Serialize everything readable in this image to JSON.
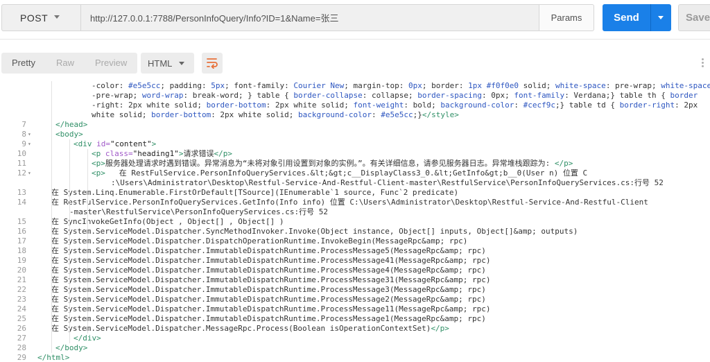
{
  "request": {
    "method": "POST",
    "url": "http://127.0.0.1:7788/PersonInfoQuery/Info?ID=1&Name=张三",
    "params_label": "Params",
    "send_label": "Send",
    "save_label": "Save"
  },
  "response_toolbar": {
    "tabs": [
      "Pretty",
      "Raw",
      "Preview"
    ],
    "active_tab": "Pretty",
    "format": "HTML"
  },
  "code_lines": [
    {
      "num": "",
      "indent": 132,
      "segments": [
        [
          "-color: ",
          "c"
        ],
        [
          "#e5e5cc",
          "k"
        ],
        [
          "; padding: ",
          "c"
        ],
        [
          "5px",
          "k"
        ],
        [
          "; font-family: ",
          "c"
        ],
        [
          "Courier New",
          "k"
        ],
        [
          "; margin-top: ",
          "c"
        ],
        [
          "0px",
          "k"
        ],
        [
          "; border: ",
          "c"
        ],
        [
          "1px #f0f0e0",
          "k"
        ],
        [
          " solid; ",
          "c"
        ],
        [
          "white-space",
          "k"
        ],
        [
          ": pre-wrap; ",
          "c"
        ],
        [
          "white-space",
          "k"
        ]
      ]
    },
    {
      "num": "",
      "indent": 132,
      "segments": [
        [
          "-pre-wrap; ",
          "c"
        ],
        [
          "word-wrap",
          "k"
        ],
        [
          ": break-word; } table { ",
          "c"
        ],
        [
          "border-collapse",
          "k"
        ],
        [
          ": collapse; ",
          "c"
        ],
        [
          "border-spacing",
          "k"
        ],
        [
          ": 0px; ",
          "c"
        ],
        [
          "font-family",
          "k"
        ],
        [
          ": Verdana;} table th { ",
          "c"
        ],
        [
          "border",
          "k"
        ]
      ]
    },
    {
      "num": "",
      "indent": 132,
      "segments": [
        [
          "-right: 2px white solid; ",
          "c"
        ],
        [
          "border-bottom",
          "k"
        ],
        [
          ": 2px white solid; ",
          "c"
        ],
        [
          "font-weight",
          "k"
        ],
        [
          ": bold; ",
          "c"
        ],
        [
          "background-color",
          "k"
        ],
        [
          ": ",
          "c"
        ],
        [
          "#cecf9c",
          "k"
        ],
        [
          ";} table td { ",
          "c"
        ],
        [
          "border-right",
          "k"
        ],
        [
          ": 2px",
          "c"
        ]
      ]
    },
    {
      "num": "",
      "indent": 132,
      "segments": [
        [
          "white solid; ",
          "c"
        ],
        [
          "border-bottom",
          "k"
        ],
        [
          ": 2px white solid; ",
          "c"
        ],
        [
          "background-color",
          "k"
        ],
        [
          ": ",
          "c"
        ],
        [
          "#e5e5cc",
          "k"
        ],
        [
          ";}",
          "c"
        ],
        [
          "</style>",
          "t"
        ]
      ]
    },
    {
      "num": "7",
      "indent": 80,
      "segments": [
        [
          "</head>",
          "t"
        ]
      ]
    },
    {
      "num": "8",
      "fold": true,
      "indent": 80,
      "segments": [
        [
          "<body>",
          "t"
        ]
      ]
    },
    {
      "num": "9",
      "fold": true,
      "indent": 106,
      "segments": [
        [
          "<div ",
          "t"
        ],
        [
          "id=",
          "a"
        ],
        [
          "\"content\"",
          "s"
        ],
        [
          ">",
          "t"
        ]
      ]
    },
    {
      "num": "10",
      "indent": 132,
      "segments": [
        [
          "<p ",
          "t"
        ],
        [
          "class=",
          "a"
        ],
        [
          "\"heading1\"",
          "s"
        ],
        [
          ">",
          "t"
        ],
        [
          "请求错误",
          "c"
        ],
        [
          "</p>",
          "t"
        ]
      ]
    },
    {
      "num": "11",
      "indent": 132,
      "segments": [
        [
          "<p>",
          "t"
        ],
        [
          "服务器处理请求时遇到错误。异常消息为“未将对象引用设置到对象的实例。”。有关详细信息，请参见服务器日志。异常堆栈跟踪为: ",
          "c"
        ],
        [
          "</p>",
          "t"
        ]
      ]
    },
    {
      "num": "12",
      "fold": true,
      "indent": 132,
      "segments": [
        [
          "<p>",
          "t"
        ],
        [
          "   在 RestFulService.PersonInfoQueryServices.&lt;&gt;c__DisplayClass3_0.&lt;GetInfo&gt;b__0(User n) 位置 C",
          "c"
        ]
      ]
    },
    {
      "num": "",
      "indent": 160,
      "segments": [
        [
          ":\\Users\\Administrator\\Desktop\\Restful-Service-And-Restful-Client-master\\RestfulService\\PersonInfoQueryServices.cs:行号 52",
          "c"
        ]
      ]
    },
    {
      "num": "13",
      "indent": 74,
      "segments": [
        [
          "在 System.Linq.Enumerable.FirstOrDefault[TSource](IEnumerable`1 source, Func`2 predicate)",
          "c"
        ]
      ]
    },
    {
      "num": "14",
      "indent": 74,
      "segments": [
        [
          "在 RestFulService.PersonInfoQueryServices.GetInfo(Info info) 位置 C:\\Users\\Administrator\\Desktop\\Restful-Service-And-Restful-Client",
          "c"
        ]
      ]
    },
    {
      "num": "",
      "indent": 100,
      "segments": [
        [
          "-master\\RestfulService\\PersonInfoQueryServices.cs:行号 52",
          "c"
        ]
      ]
    },
    {
      "num": "15",
      "indent": 74,
      "segments": [
        [
          "在 SyncInvokeGetInfo(Object , Object[] , Object[] )",
          "c"
        ]
      ]
    },
    {
      "num": "16",
      "indent": 74,
      "segments": [
        [
          "在 System.ServiceModel.Dispatcher.SyncMethodInvoker.Invoke(Object instance, Object[] inputs, Object[]&amp; outputs)",
          "c"
        ]
      ]
    },
    {
      "num": "17",
      "indent": 74,
      "segments": [
        [
          "在 System.ServiceModel.Dispatcher.DispatchOperationRuntime.InvokeBegin(MessageRpc&amp; rpc)",
          "c"
        ]
      ]
    },
    {
      "num": "18",
      "indent": 74,
      "segments": [
        [
          "在 System.ServiceModel.Dispatcher.ImmutableDispatchRuntime.ProcessMessage5(MessageRpc&amp; rpc)",
          "c"
        ]
      ]
    },
    {
      "num": "19",
      "indent": 74,
      "segments": [
        [
          "在 System.ServiceModel.Dispatcher.ImmutableDispatchRuntime.ProcessMessage41(MessageRpc&amp; rpc)",
          "c"
        ]
      ]
    },
    {
      "num": "20",
      "indent": 74,
      "segments": [
        [
          "在 System.ServiceModel.Dispatcher.ImmutableDispatchRuntime.ProcessMessage4(MessageRpc&amp; rpc)",
          "c"
        ]
      ]
    },
    {
      "num": "21",
      "indent": 74,
      "segments": [
        [
          "在 System.ServiceModel.Dispatcher.ImmutableDispatchRuntime.ProcessMessage31(MessageRpc&amp; rpc)",
          "c"
        ]
      ]
    },
    {
      "num": "22",
      "indent": 74,
      "segments": [
        [
          "在 System.ServiceModel.Dispatcher.ImmutableDispatchRuntime.ProcessMessage3(MessageRpc&amp; rpc)",
          "c"
        ]
      ]
    },
    {
      "num": "23",
      "indent": 74,
      "segments": [
        [
          "在 System.ServiceModel.Dispatcher.ImmutableDispatchRuntime.ProcessMessage2(MessageRpc&amp; rpc)",
          "c"
        ]
      ]
    },
    {
      "num": "24",
      "indent": 74,
      "segments": [
        [
          "在 System.ServiceModel.Dispatcher.ImmutableDispatchRuntime.ProcessMessage11(MessageRpc&amp; rpc)",
          "c"
        ]
      ]
    },
    {
      "num": "25",
      "indent": 74,
      "segments": [
        [
          "在 System.ServiceModel.Dispatcher.ImmutableDispatchRuntime.ProcessMessage1(MessageRpc&amp; rpc)",
          "c"
        ]
      ]
    },
    {
      "num": "26",
      "indent": 74,
      "segments": [
        [
          "在 System.ServiceModel.Dispatcher.MessageRpc.Process(Boolean isOperationContextSet)",
          "c"
        ],
        [
          "</p>",
          "t"
        ]
      ]
    },
    {
      "num": "27",
      "indent": 106,
      "segments": [
        [
          "</div>",
          "t"
        ]
      ]
    },
    {
      "num": "28",
      "indent": 80,
      "segments": [
        [
          "</body>",
          "t"
        ]
      ]
    },
    {
      "num": "29",
      "indent": 54,
      "segments": [
        [
          "</html>",
          "t"
        ]
      ]
    }
  ],
  "icons": {
    "method_dropdown": "chevron-down-icon",
    "send_dropdown": "chevron-down-icon",
    "wrap": "word-wrap-icon",
    "more": "more-options-icon"
  },
  "colors": {
    "send": "#1a80e8",
    "wrap_icon": "#e8703a",
    "tag": "#2f8f66",
    "attr": "#a15ac9",
    "css_keyword": "#2d56c0"
  }
}
